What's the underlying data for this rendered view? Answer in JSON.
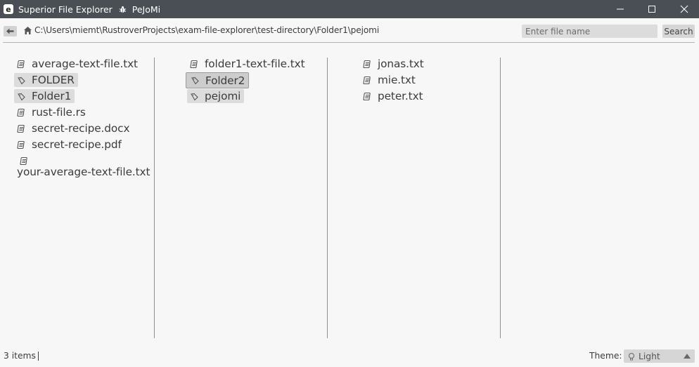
{
  "window": {
    "app_letter": "e",
    "title": "Superior File Explorer",
    "subtitle": "PeJoMi"
  },
  "toolbar": {
    "path": "C:\\Users\\miemt\\RustroverProjects\\exam-file-explorer\\test-directory\\Folder1\\pejomi",
    "search_placeholder": "Enter file name",
    "search_value": "",
    "search_label": "Search"
  },
  "columns": [
    {
      "entries": [
        {
          "name": "average-text-file.txt",
          "type": "file"
        },
        {
          "name": "FOLDER",
          "type": "folder"
        },
        {
          "name": "Folder1",
          "type": "folder"
        },
        {
          "name": "rust-file.rs",
          "type": "file"
        },
        {
          "name": "secret-recipe.docx",
          "type": "file"
        },
        {
          "name": "secret-recipe.pdf",
          "type": "file"
        },
        {
          "name": "your-average-text-file.txt",
          "type": "file"
        }
      ]
    },
    {
      "entries": [
        {
          "name": "folder1-text-file.txt",
          "type": "file"
        },
        {
          "name": "Folder2",
          "type": "folder",
          "selected": true
        },
        {
          "name": "pejomi",
          "type": "folder"
        }
      ]
    },
    {
      "entries": [
        {
          "name": "jonas.txt",
          "type": "file"
        },
        {
          "name": "mie.txt",
          "type": "file"
        },
        {
          "name": "peter.txt",
          "type": "file"
        }
      ]
    }
  ],
  "status": {
    "items_text": "3 items",
    "theme_label": "Theme:",
    "theme_value": "Light"
  },
  "colors": {
    "titlebar": "#4a4f56",
    "background": "#f7f7f7",
    "folder_highlight": "#dcdcdc",
    "text": "#3c3c3c"
  },
  "icons": {
    "file": "file-icon",
    "folder": "folder-icon",
    "home": "home-icon",
    "back": "back-arrow-icon",
    "theme": "lightbulb-icon"
  }
}
